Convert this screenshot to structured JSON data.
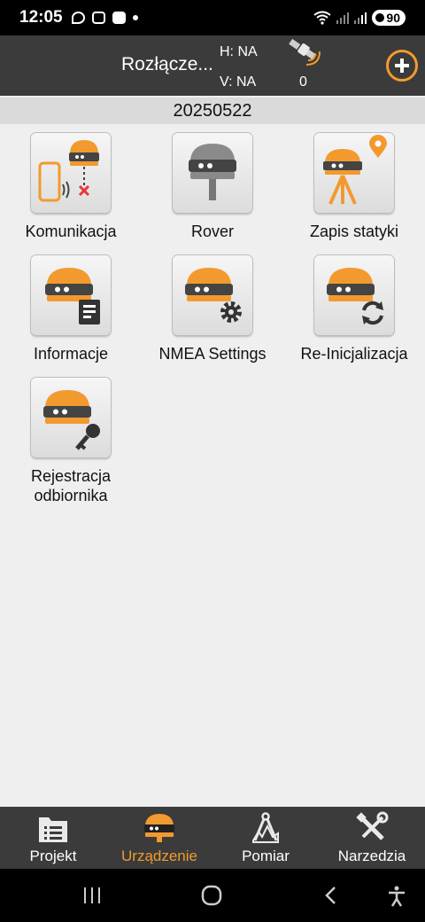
{
  "status_bar": {
    "time": "12:05",
    "battery": "90"
  },
  "header": {
    "connection_status": "Rozłącze...",
    "h_value": "H: NA",
    "v_value": "V: NA",
    "satellite_count": "0"
  },
  "date_bar": {
    "date": "20250522"
  },
  "tiles": [
    {
      "label": "Komunikacja"
    },
    {
      "label": "Rover"
    },
    {
      "label": "Zapis statyki"
    },
    {
      "label": "Informacje"
    },
    {
      "label": "NMEA Settings"
    },
    {
      "label": "Re-Inicjalizacja"
    },
    {
      "label": "Rejestracja odbiornika"
    }
  ],
  "bottom_nav": [
    {
      "label": "Projekt",
      "active": false
    },
    {
      "label": "Urządzenie",
      "active": true
    },
    {
      "label": "Pomiar",
      "active": false
    },
    {
      "label": "Narzedzia",
      "active": false
    }
  ],
  "colors": {
    "accent": "#f29a2e",
    "header_bg": "#3b3b3b",
    "page_bg": "#efefef",
    "date_bar_bg": "#dadada"
  }
}
